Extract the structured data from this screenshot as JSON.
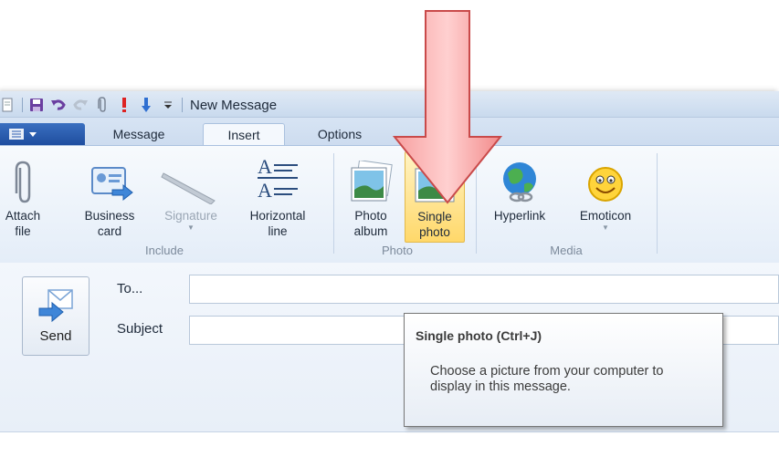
{
  "titlebar": {
    "title": "New Message"
  },
  "qat_icons": [
    "new-icon",
    "save-icon",
    "undo-icon",
    "redo-icon",
    "attach-icon",
    "priority-high-icon",
    "priority-low-icon",
    "customize-icon"
  ],
  "tabs": [
    {
      "label": "Message",
      "active": false
    },
    {
      "label": "Insert",
      "active": true
    },
    {
      "label": "Options",
      "active": false
    }
  ],
  "ribbon": {
    "groups": {
      "include": "Include",
      "photo": "Photo",
      "media": "Media"
    },
    "buttons": {
      "attach_file": [
        "Attach",
        "file"
      ],
      "business_card": [
        "Business",
        "card"
      ],
      "signature": "Signature",
      "horizontal_line": [
        "Horizontal",
        "line"
      ],
      "photo_album": [
        "Photo",
        "album"
      ],
      "single_photo": [
        "Single",
        "photo"
      ],
      "hyperlink": "Hyperlink",
      "emoticon": "Emoticon"
    }
  },
  "compose": {
    "send_label": "Send",
    "to_label": "To...",
    "subject_label": "Subject",
    "to_value": "",
    "subject_value": ""
  },
  "tooltip": {
    "title": "Single photo (Ctrl+J)",
    "body": "Choose a picture from your computer to display in this message."
  },
  "colors": {
    "accent": "#1f4e9f",
    "hover": "#ffd86a",
    "arrow": "#f28b8b"
  }
}
